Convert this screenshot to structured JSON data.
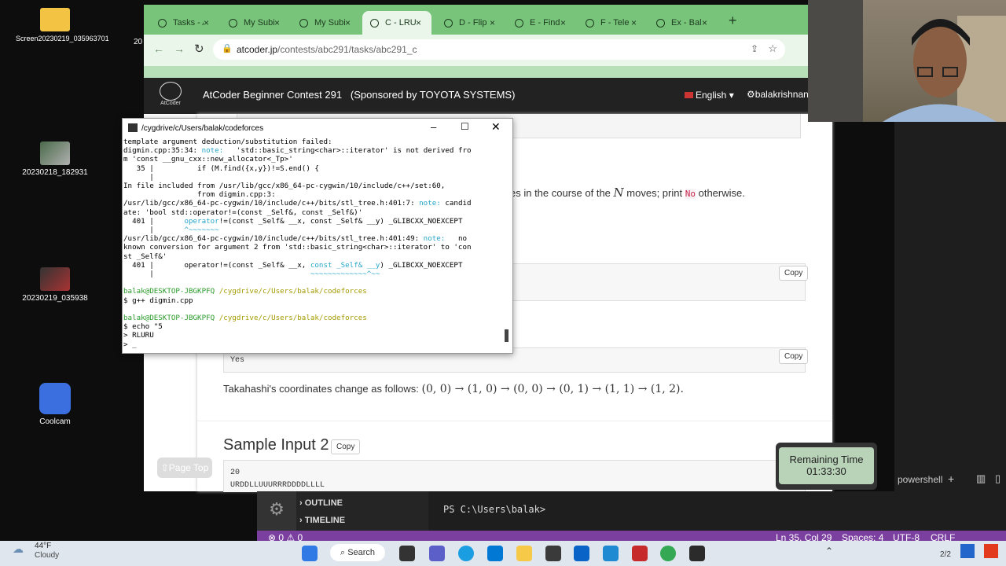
{
  "desktop": {
    "icons": [
      {
        "label": "Screen20230219_035963701"
      },
      {
        "label": "20230218_182931"
      },
      {
        "label": "20230219_035938"
      },
      {
        "label": "Coolcam"
      }
    ],
    "left_cut_label": "20"
  },
  "browser": {
    "tabs": [
      {
        "label": "Tasks - A"
      },
      {
        "label": "My Subi"
      },
      {
        "label": "My Subi"
      },
      {
        "label": "C - LRUD"
      },
      {
        "label": "D - Flip"
      },
      {
        "label": "E - Find"
      },
      {
        "label": "F - Tele"
      },
      {
        "label": "Ex - Bal"
      }
    ],
    "new_tab": "+",
    "url_host": "atcoder.jp",
    "url_path": "/contests/abc291/tasks/abc291_c",
    "site": {
      "logo_text": "AtCoder",
      "contest_title": "AtCoder Beginner Contest 291   (Sponsored by TOYOTA SYSTEMS)",
      "language": "English",
      "user": "balakrishnan"
    },
    "page": {
      "statement_text_a": "es in the course of the",
      "statement_var": "N",
      "statement_text_b": "moves; print",
      "statement_no": "No",
      "statement_text_c": "otherwise.",
      "copy": "Copy",
      "sample_output_1": "Yes",
      "explanation_text": "Takahashi's coordinates change as follows:",
      "explanation_math": "(0, 0) → (1, 0) → (0, 0) → (0, 1) → (1, 1) → (1, 2).",
      "sample_input_2_heading": "Sample Input 2",
      "sample_input_2_lines": [
        "20",
        "URDDLLUUURRRDDDDLLLL"
      ],
      "page_top": "Page Top"
    }
  },
  "terminal": {
    "title": "/cygdrive/c/Users/balak/codeforces",
    "lines": [
      {
        "t": "template argument deduction/substitution failed:"
      },
      {
        "t": "digmin.cpp:35:34: ",
        "c": "note:",
        "r": "   'std::basic_string<char>::iterator' is not derived fro"
      },
      {
        "t": "m 'const __gnu_cxx::new_allocator<_Tp>'"
      },
      {
        "t": "   35 |          if (M.find({x,y})!=S.end() {"
      },
      {
        "t": "      |"
      },
      {
        "t": "In file included from /usr/lib/gcc/x86_64-pc-cygwin/10/include/c++/set:60,"
      },
      {
        "t": "                 from digmin.cpp:3:"
      },
      {
        "t": "/usr/lib/gcc/x86_64-pc-cygwin/10/include/c++/bits/stl_tree.h:401:7: ",
        "c": "note:",
        "r": " candid"
      },
      {
        "t": "ate: 'bool std::operator!=(const _Self&, const _Self&)'"
      },
      {
        "t": "  401 |       ",
        "c": "operator",
        "r": "!=(const _Self& __x, const _Self& __y) _GLIBCXX_NOEXCEPT"
      },
      {
        "t": "      |       ",
        "c": "^~~~~~~~"
      },
      {
        "t": "/usr/lib/gcc/x86_64-pc-cygwin/10/include/c++/bits/stl_tree.h:401:49: ",
        "c": "note:",
        "r": "   no"
      },
      {
        "t": "known conversion for argument 2 from 'std::basic_string<char>::iterator' to 'con"
      },
      {
        "t": "st _Self&'"
      },
      {
        "t": "  401 |       operator!=(const _Self& __x, ",
        "c": "const _Self& __y",
        "r": ") _GLIBCXX_NOEXCEPT"
      },
      {
        "t": "      |                                    ",
        "c": "~~~~~~~~~~~~~^~~"
      },
      {
        "t": ""
      },
      {
        "t": "",
        "g": "balak@DESKTOP-JBGKPFQ",
        "y": " /cygdrive/c/Users/balak/codeforces"
      },
      {
        "t": "$ g++ digmin.cpp"
      },
      {
        "t": ""
      },
      {
        "t": "",
        "g": "balak@DESKTOP-JBGKPFQ",
        "y": " /cygdrive/c/Users/balak/codeforces"
      },
      {
        "t": "$ echo \"5"
      },
      {
        "t": "> RLURU"
      },
      {
        "t": "> _"
      }
    ]
  },
  "vscode": {
    "outline": "OUTLINE",
    "timeline": "TIMELINE",
    "terminal_prompt": "PS C:\\Users\\balak>",
    "panel_label": "powershell",
    "status": {
      "errors": "0",
      "warnings": "0",
      "position": "Ln 35, Col 29",
      "spaces": "Spaces: 4",
      "encoding": "UTF-8",
      "eol": "CRLF"
    }
  },
  "timer": {
    "label": "Remaining Time",
    "value": "01:33:30"
  },
  "taskbar": {
    "temperature": "44°F",
    "weather": "Cloudy",
    "search": "Search",
    "date_partial": "2/2"
  }
}
